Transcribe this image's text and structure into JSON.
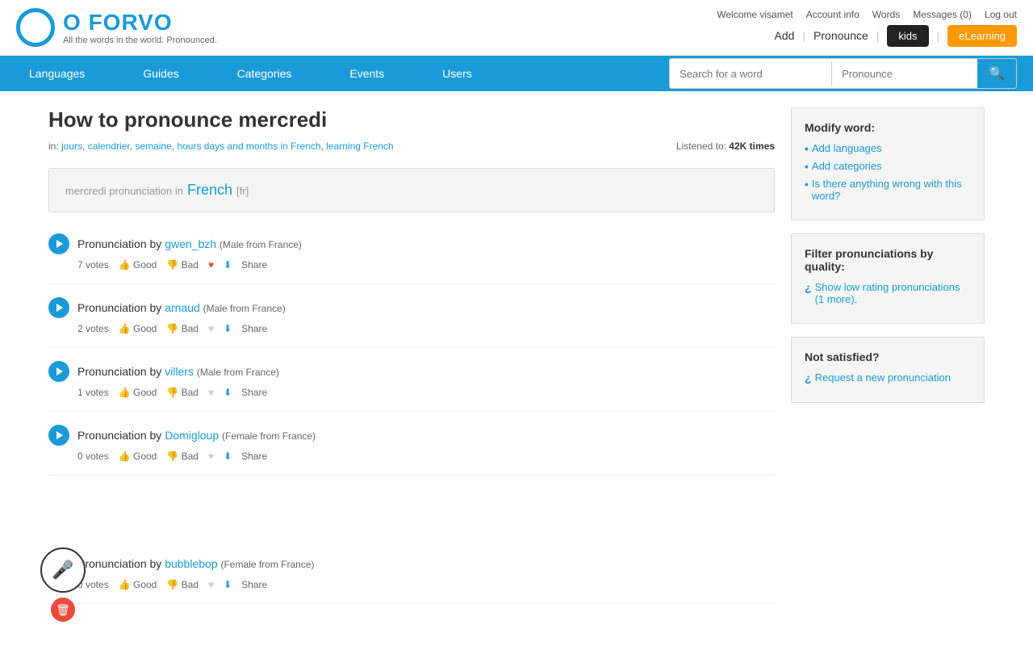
{
  "header": {
    "logo_text": "FORVO",
    "logo_tagline": "All the words in the world. Pronounced.",
    "welcome": "Welcome visamet",
    "account_info": "Account info",
    "words": "Words",
    "messages": "Messages (0)",
    "log_out": "Log out",
    "add": "Add",
    "pronounce": "Pronounce",
    "kids_label": "kids",
    "elearning_label": "eLearning"
  },
  "nav": {
    "items": [
      {
        "label": "Languages"
      },
      {
        "label": "Guides"
      },
      {
        "label": "Categories"
      },
      {
        "label": "Events"
      },
      {
        "label": "Users"
      }
    ]
  },
  "search": {
    "word_placeholder": "Search for a word",
    "pronounce_placeholder": "Pronounce",
    "button_label": "🔍"
  },
  "page": {
    "title": "How to pronounce mercredi",
    "categories": [
      {
        "label": "jours",
        "href": "#"
      },
      {
        "label": "calendrier",
        "href": "#"
      },
      {
        "label": "semaine",
        "href": "#"
      },
      {
        "label": "hours days and months in French",
        "href": "#"
      },
      {
        "label": "learning French",
        "href": "#"
      }
    ],
    "listened_label": "Listened to:",
    "listened_count": "42K times",
    "pronunciation_heading": "mercredi pronunciation in",
    "language": "French",
    "lang_code": "[fr]"
  },
  "entries": [
    {
      "label": "Pronunciation by",
      "user": "gwen_bzh",
      "meta": "(Male from France)",
      "votes": "7 votes",
      "good": "Good",
      "bad": "Bad",
      "share": "Share",
      "has_heart": true,
      "has_arrow": true
    },
    {
      "label": "Pronunciation by",
      "user": "arnaud",
      "meta": "(Male from France)",
      "votes": "2 votes",
      "good": "Good",
      "bad": "Bad",
      "share": "Share",
      "has_heart": false,
      "has_arrow": true
    },
    {
      "label": "Pronunciation by",
      "user": "villers",
      "meta": "(Male from France)",
      "votes": "1 votes",
      "good": "Good",
      "bad": "Bad",
      "share": "Share",
      "has_heart": false,
      "has_arrow": true
    },
    {
      "label": "Pronunciation by",
      "user": "Domigloup",
      "meta": "(Female from France)",
      "votes": "0 votes",
      "good": "Good",
      "bad": "Bad",
      "share": "Share",
      "has_heart": false,
      "has_arrow": true
    },
    {
      "label": "Pronunciation by",
      "user": "bubblebop",
      "meta": "(Female from France)",
      "votes": "0 votes",
      "good": "Good",
      "bad": "Bad",
      "share": "Share",
      "has_heart": false,
      "has_arrow": true
    }
  ],
  "sidebar": {
    "modify_title": "Modify word:",
    "modify_items": [
      {
        "label": "Add languages",
        "href": "#"
      },
      {
        "label": "Add categories",
        "href": "#"
      },
      {
        "label": "Is there anything wrong with this word?",
        "href": "#"
      }
    ],
    "filter_title": "Filter pronunciations by quality:",
    "filter_link": "Show low rating pronunciations (1 more).",
    "not_satisfied_title": "Not satisfied?",
    "request_link": "Request a new pronunciation"
  }
}
